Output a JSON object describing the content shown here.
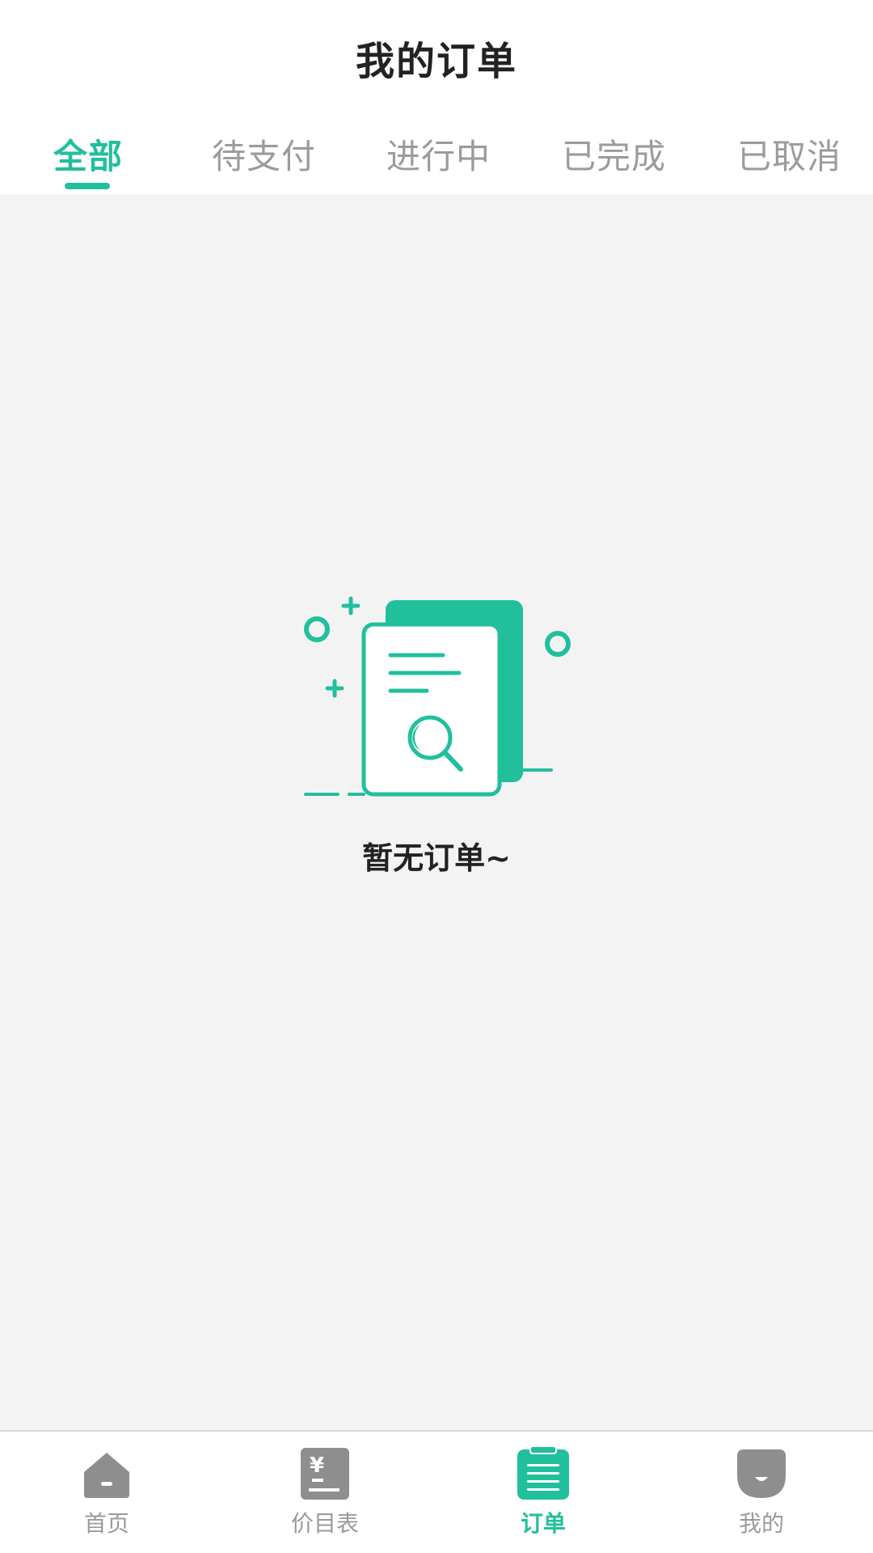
{
  "header": {
    "title": "我的订单"
  },
  "tabs": [
    {
      "label": "全部",
      "active": true
    },
    {
      "label": "待支付",
      "active": false
    },
    {
      "label": "进行中",
      "active": false
    },
    {
      "label": "已完成",
      "active": false
    },
    {
      "label": "已取消",
      "active": false
    }
  ],
  "empty_state": {
    "icon": "document-search-icon",
    "message": "暂无订单~"
  },
  "bottom_nav": [
    {
      "label": "首页",
      "icon": "home-icon",
      "active": false
    },
    {
      "label": "价目表",
      "icon": "price-list-icon",
      "active": false
    },
    {
      "label": "订单",
      "icon": "orders-clipboard-icon",
      "active": true
    },
    {
      "label": "我的",
      "icon": "profile-icon",
      "active": false
    }
  ],
  "colors": {
    "accent": "#22bf9d",
    "inactive_text": "#9b9b9b",
    "nav_icon_gray": "#8e8e8e",
    "background": "#f3f3f3",
    "title_text": "#222222"
  }
}
